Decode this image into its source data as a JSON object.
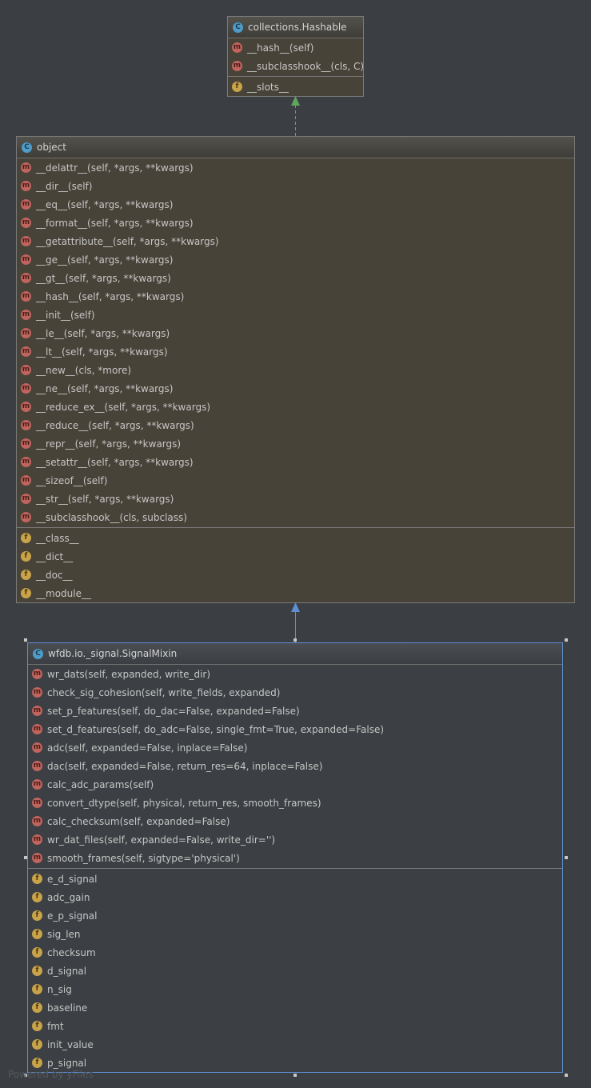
{
  "colors": {
    "realization_edge": "#5fa55a",
    "inheritance_edge": "#5c8fd4",
    "selected_border": "#5c8fd4"
  },
  "hashable": {
    "name": "collections.Hashable",
    "methods": [
      "__hash__(self)",
      "__subclasshook__(cls, C)"
    ],
    "fields": [
      "__slots__"
    ]
  },
  "object": {
    "name": "object",
    "methods": [
      "__delattr__(self, *args, **kwargs)",
      "__dir__(self)",
      "__eq__(self, *args, **kwargs)",
      "__format__(self, *args, **kwargs)",
      "__getattribute__(self, *args, **kwargs)",
      "__ge__(self, *args, **kwargs)",
      "__gt__(self, *args, **kwargs)",
      "__hash__(self, *args, **kwargs)",
      "__init__(self)",
      "__le__(self, *args, **kwargs)",
      "__lt__(self, *args, **kwargs)",
      "__new__(cls, *more)",
      "__ne__(self, *args, **kwargs)",
      "__reduce_ex__(self, *args, **kwargs)",
      "__reduce__(self, *args, **kwargs)",
      "__repr__(self, *args, **kwargs)",
      "__setattr__(self, *args, **kwargs)",
      "__sizeof__(self)",
      "__str__(self, *args, **kwargs)",
      "__subclasshook__(cls, subclass)"
    ],
    "fields": [
      "__class__",
      "__dict__",
      "__doc__",
      "__module__"
    ]
  },
  "signalmixin": {
    "name": "wfdb.io._signal.SignalMixin",
    "methods": [
      "wr_dats(self, expanded, write_dir)",
      "check_sig_cohesion(self, write_fields, expanded)",
      "set_p_features(self, do_dac=False, expanded=False)",
      "set_d_features(self, do_adc=False, single_fmt=True, expanded=False)",
      "adc(self, expanded=False, inplace=False)",
      "dac(self, expanded=False, return_res=64, inplace=False)",
      "calc_adc_params(self)",
      "convert_dtype(self, physical, return_res, smooth_frames)",
      "calc_checksum(self, expanded=False)",
      "wr_dat_files(self, expanded=False, write_dir='')",
      "smooth_frames(self, sigtype='physical')"
    ],
    "fields": [
      "e_d_signal",
      "adc_gain",
      "e_p_signal",
      "sig_len",
      "checksum",
      "d_signal",
      "n_sig",
      "baseline",
      "fmt",
      "init_value",
      "p_signal"
    ]
  },
  "icons": {
    "class": "C",
    "method": "m",
    "field": "f"
  },
  "watermark": "Powered by yFiles"
}
